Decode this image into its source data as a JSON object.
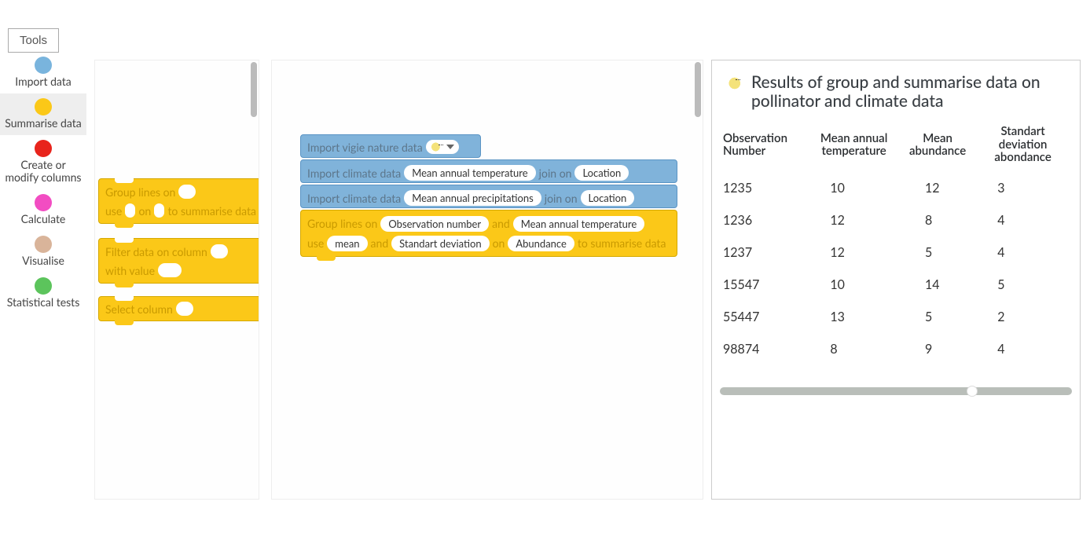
{
  "tools_button": "Tools",
  "sidebar": [
    {
      "label": "Import data",
      "color": "#79b4dd",
      "selected": false
    },
    {
      "label": "Summarise data",
      "color": "#fbc818",
      "selected": true
    },
    {
      "label": "Create or modify columns",
      "color": "#e8241c",
      "selected": false
    },
    {
      "label": "Calculate",
      "color": "#f24dc2",
      "selected": false
    },
    {
      "label": "Visualise",
      "color": "#d9b49a",
      "selected": false
    },
    {
      "label": "Statistical tests",
      "color": "#5cc45c",
      "selected": false
    }
  ],
  "palette_blocks": {
    "group": {
      "line1_pre": "Group lines on",
      "line2_pre": "use",
      "line2_mid": "on",
      "line2_post": "to summarise data"
    },
    "filter": {
      "line1_pre": "Filter data on column",
      "line2_pre": "with value"
    },
    "select": {
      "label": "Select column"
    }
  },
  "canvas_blocks": {
    "b1": {
      "label": "Import vigie nature data"
    },
    "b2": {
      "label": "Import climate data",
      "chip": "Mean annual temperature",
      "join": "join on",
      "loc": "Location"
    },
    "b3": {
      "label": "Import climate data",
      "chip": "Mean annual precipitations",
      "join": "join on",
      "loc": "Location"
    },
    "b4": {
      "line1_pre": "Group lines on",
      "chip1": "Observation number",
      "and1": "and",
      "chip2": "Mean annual temperature",
      "line2_pre": "use",
      "chip3": "mean",
      "and2": "and",
      "chip4": "Standart deviation",
      "on": "on",
      "chip5": "Abundance",
      "post": "to summarise data"
    }
  },
  "results": {
    "title": "Results of group and summarise data on pollinator and climate data",
    "headers": [
      "Observation Number",
      "Mean annual temperature",
      "Mean abundance",
      "Standart deviation abondance"
    ],
    "rows": [
      [
        "1235",
        "10",
        "12",
        "3"
      ],
      [
        "1236",
        "12",
        "8",
        "4"
      ],
      [
        "1237",
        "12",
        "5",
        "4"
      ],
      [
        "15547",
        "10",
        "14",
        "5"
      ],
      [
        "55447",
        "13",
        "5",
        "2"
      ],
      [
        "98874",
        "8",
        "9",
        "4"
      ]
    ]
  }
}
